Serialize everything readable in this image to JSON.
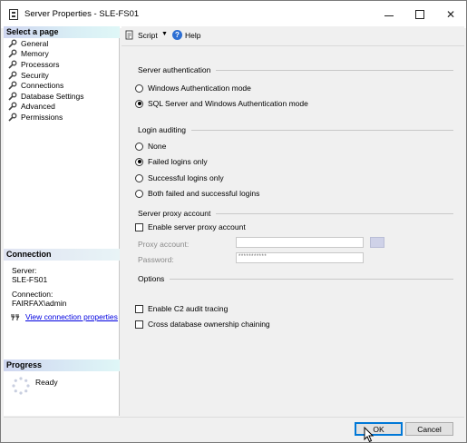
{
  "window": {
    "title": "Server Properties - SLE-FS01"
  },
  "left": {
    "select_page_header": "Select a page",
    "pages": [
      "General",
      "Memory",
      "Processors",
      "Security",
      "Connections",
      "Database Settings",
      "Advanced",
      "Permissions"
    ],
    "connection_header": "Connection",
    "server_label": "Server:",
    "server_value": "SLE-FS01",
    "connection_label": "Connection:",
    "connection_value": "FAIRFAX\\admin",
    "view_connection_link": "View connection properties",
    "progress_header": "Progress",
    "progress_status": "Ready"
  },
  "toolbar": {
    "script_label": "Script",
    "help_label": "Help"
  },
  "server_auth": {
    "label": "Server authentication",
    "options": [
      "Windows Authentication mode",
      "SQL Server and Windows Authentication mode"
    ],
    "selected_index": 1
  },
  "login_auditing": {
    "label": "Login auditing",
    "options": [
      "None",
      "Failed logins only",
      "Successful logins only",
      "Both failed and successful logins"
    ],
    "selected_index": 1
  },
  "proxy": {
    "label": "Server proxy account",
    "enable_label": "Enable server proxy account",
    "account_label": "Proxy account:",
    "account_value": "",
    "password_label": "Password:",
    "password_value": "***********"
  },
  "options": {
    "label": "Options",
    "c2_label": "Enable C2 audit tracing",
    "chaining_label": "Cross database ownership chaining"
  },
  "buttons": {
    "ok": "OK",
    "cancel": "Cancel"
  },
  "colors": {
    "link": "#0000e0",
    "ok_border": "#0078d7",
    "header_gradient_start": "#cfd6f0",
    "header_gradient_end": "#dff7f7"
  }
}
